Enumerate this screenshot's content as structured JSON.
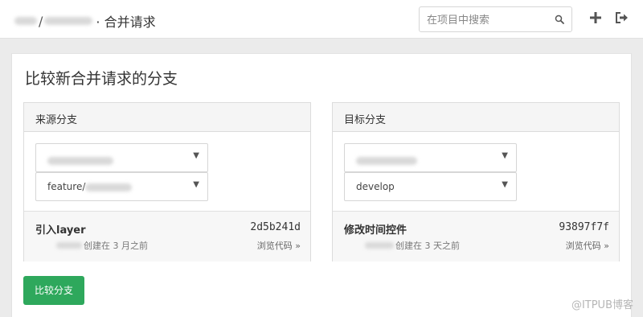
{
  "header": {
    "breadcrumb_separator": "/",
    "page_title": "· 合并请求",
    "search": {
      "placeholder": "在项目中搜索"
    },
    "icons": [
      "search-icon",
      "plus-icon",
      "sign-out-icon"
    ]
  },
  "main": {
    "title": "比较新合并请求的分支",
    "source": {
      "heading": "来源分支",
      "branch_prefix": "feature/",
      "commit": {
        "message": "引入layer",
        "hash": "2d5b241d",
        "time": "创建在 3 月之前",
        "browse_link": "浏览代码 »"
      }
    },
    "target": {
      "heading": "目标分支",
      "branch": "develop",
      "commit": {
        "message": "修改时间控件",
        "hash": "93897f7f",
        "time": "创建在 3 天之前",
        "browse_link": "浏览代码 »"
      }
    },
    "compare_button": "比较分支"
  },
  "watermark": "@ITPUB博客",
  "colors": {
    "accent_green": "#2ea85c"
  }
}
